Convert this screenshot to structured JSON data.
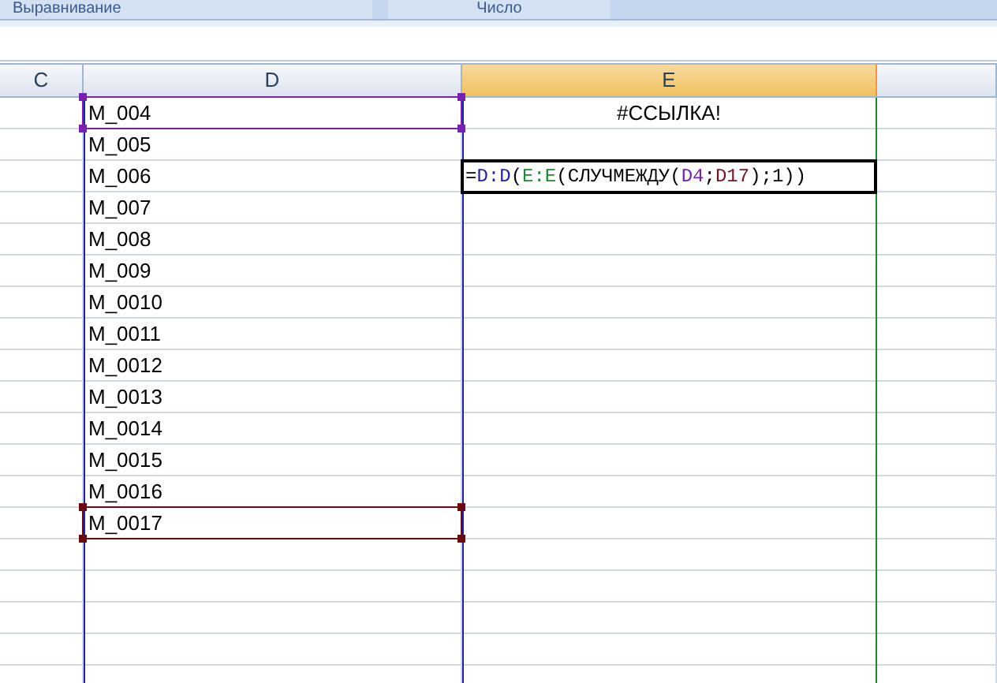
{
  "ribbon_groups": [
    {
      "label": "Выравнивание"
    },
    {
      "label": "Число"
    }
  ],
  "columns": [
    {
      "label": "C",
      "selected": false
    },
    {
      "label": "D",
      "selected": false,
      "color": "#2020b0"
    },
    {
      "label": "E",
      "selected": true,
      "color": "#1a8a2a"
    }
  ],
  "rows": [
    {
      "d": "M_004",
      "e": "#ССЫЛКА!",
      "range": {
        "color": "#7a20b0"
      }
    },
    {
      "d": "M_005"
    },
    {
      "d": "M_006",
      "editing": true,
      "formula": [
        {
          "text": "=",
          "color": "#000000"
        },
        {
          "text": "D:D",
          "color": "#2020b0"
        },
        {
          "text": "(",
          "color": "#000000"
        },
        {
          "text": "E:E",
          "color": "#1a8a2a"
        },
        {
          "text": "(СЛУЧМЕЖДУ(",
          "color": "#000000"
        },
        {
          "text": "D4",
          "color": "#7a20b0"
        },
        {
          "text": ";",
          "color": "#000000"
        },
        {
          "text": "D17",
          "color": "#7a1020"
        },
        {
          "text": ");1))",
          "color": "#000000"
        }
      ]
    },
    {
      "d": "M_007"
    },
    {
      "d": "M_008"
    },
    {
      "d": "M_009"
    },
    {
      "d": "M_0010"
    },
    {
      "d": "M_0011"
    },
    {
      "d": "M_0012"
    },
    {
      "d": "M_0013"
    },
    {
      "d": "M_0014"
    },
    {
      "d": "M_0015"
    },
    {
      "d": "M_0016"
    },
    {
      "d": "M_0017",
      "range": {
        "color": "#6a0a10"
      }
    }
  ]
}
